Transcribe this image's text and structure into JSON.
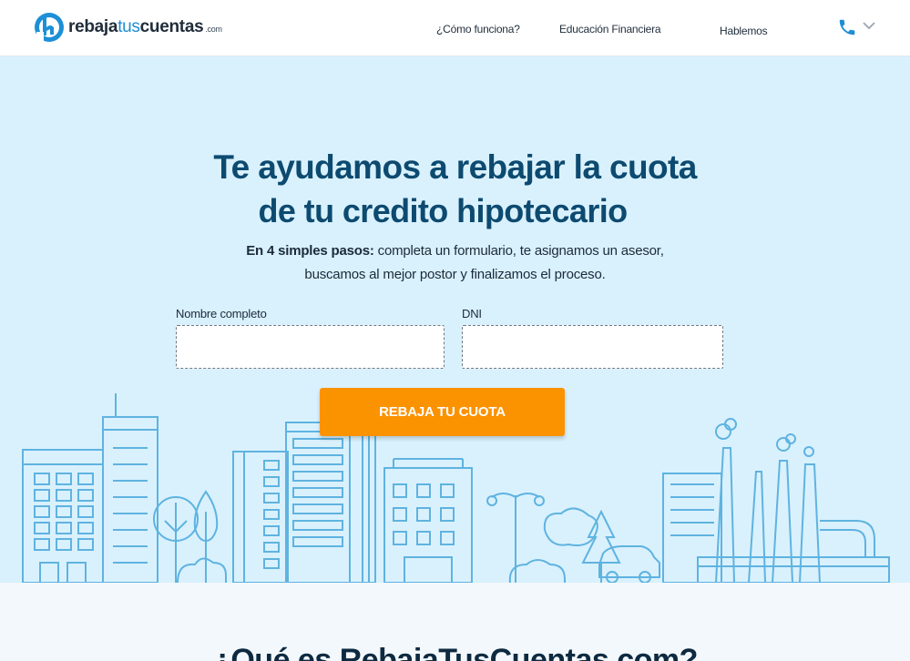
{
  "header": {
    "logo": {
      "bold1": "rebaja",
      "light": "tus",
      "bold2": "cuentas",
      "suffix": ".com"
    },
    "nav": [
      {
        "label": "¿Cómo funciona?"
      },
      {
        "label": "Educación Financiera"
      },
      {
        "label": "Hablemos"
      }
    ],
    "icons": {
      "phone": "phone-icon",
      "dropdown": "chevron-down-icon"
    }
  },
  "hero": {
    "title_line1": "Te ayudamos a rebajar la cuota",
    "title_line2": "de tu credito hipotecario",
    "subtitle_bold": "En 4 simples pasos:",
    "subtitle_rest": " completa un formulario, te asignamos un asesor,",
    "subtitle_line2": "buscamos al mejor postor y finalizamos el proceso.",
    "form": {
      "name_label": "Nombre completo",
      "name_value": "",
      "dni_label": "DNI",
      "dni_value": ""
    },
    "cta_label": "REBAJA TU CUOTA"
  },
  "section": {
    "title": "¿Qué es RebajaTusCuentas.com?"
  },
  "colors": {
    "accent": "#fb9200",
    "brand_blue": "#1d8fd6",
    "hero_bg": "#d9f1fd",
    "title_navy": "#0d4a70",
    "illustration_stroke": "#5fb3e0"
  }
}
